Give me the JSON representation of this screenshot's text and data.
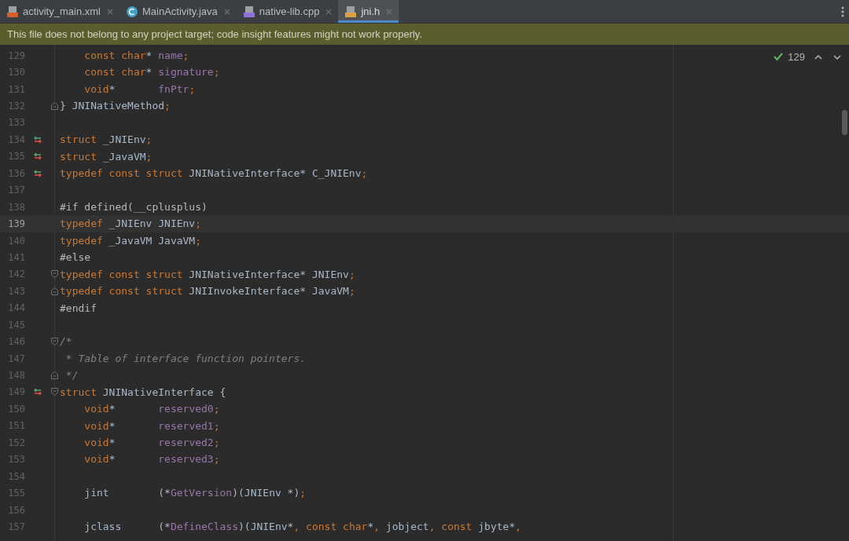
{
  "tabs": [
    {
      "label": "activity_main.xml",
      "kind": "xml",
      "selected": false
    },
    {
      "label": "MainActivity.java",
      "kind": "java",
      "selected": false
    },
    {
      "label": "native-lib.cpp",
      "kind": "cpp",
      "selected": false
    },
    {
      "label": "jni.h",
      "kind": "header",
      "selected": true
    }
  ],
  "banner": {
    "text": "This file does not belong to any project target; code insight features might not work properly."
  },
  "inspection": {
    "count": "129"
  },
  "lines": [
    {
      "number": "129",
      "current": false,
      "implemented": false,
      "fold_start": false,
      "fold_end": false,
      "tokens": [
        {
          "kind": "keyword",
          "text": "    const char"
        },
        {
          "kind": "plain",
          "text": "* "
        },
        {
          "kind": "field",
          "text": "name"
        },
        {
          "kind": "punct",
          "text": ";"
        }
      ]
    },
    {
      "number": "130",
      "current": false,
      "implemented": false,
      "fold_start": false,
      "fold_end": false,
      "tokens": [
        {
          "kind": "keyword",
          "text": "    const char"
        },
        {
          "kind": "plain",
          "text": "* "
        },
        {
          "kind": "field",
          "text": "signature"
        },
        {
          "kind": "punct",
          "text": ";"
        }
      ]
    },
    {
      "number": "131",
      "current": false,
      "implemented": false,
      "fold_start": false,
      "fold_end": false,
      "tokens": [
        {
          "kind": "keyword",
          "text": "    void"
        },
        {
          "kind": "plain",
          "text": "*       "
        },
        {
          "kind": "field",
          "text": "fnPtr"
        },
        {
          "kind": "punct",
          "text": ";"
        }
      ]
    },
    {
      "number": "132",
      "current": false,
      "implemented": false,
      "fold_start": false,
      "fold_end": true,
      "tokens": [
        {
          "kind": "plain",
          "text": "} JNINativeMethod"
        },
        {
          "kind": "punct",
          "text": ";"
        }
      ]
    },
    {
      "number": "133",
      "current": false,
      "implemented": false,
      "fold_start": false,
      "fold_end": false
    },
    {
      "number": "134",
      "current": false,
      "implemented": true,
      "fold_start": false,
      "fold_end": false,
      "tokens": [
        {
          "kind": "keyword",
          "text": "struct"
        },
        {
          "kind": "plain",
          "text": " _JNIEnv"
        },
        {
          "kind": "punct",
          "text": ";"
        }
      ]
    },
    {
      "number": "135",
      "current": false,
      "implemented": true,
      "fold_start": false,
      "fold_end": false,
      "tokens": [
        {
          "kind": "keyword",
          "text": "struct"
        },
        {
          "kind": "plain",
          "text": " _JavaVM"
        },
        {
          "kind": "punct",
          "text": ";"
        }
      ]
    },
    {
      "number": "136",
      "current": false,
      "implemented": true,
      "fold_start": false,
      "fold_end": false,
      "tokens": [
        {
          "kind": "keyword",
          "text": "typedef const struct"
        },
        {
          "kind": "plain",
          "text": " JNINativeInterface* C_JNIEnv"
        },
        {
          "kind": "punct",
          "text": ";"
        }
      ]
    },
    {
      "number": "137",
      "current": false,
      "implemented": false,
      "fold_start": false,
      "fold_end": false
    },
    {
      "number": "138",
      "current": false,
      "implemented": false,
      "fold_start": false,
      "fold_end": false,
      "tokens": [
        {
          "kind": "directive",
          "text": "#if defined(__cplusplus)"
        }
      ]
    },
    {
      "number": "139",
      "current": true,
      "implemented": false,
      "fold_start": false,
      "fold_end": false,
      "tokens": [
        {
          "kind": "keyword",
          "text": "typedef"
        },
        {
          "kind": "plain",
          "text": " _JNIEnv JNIEnv"
        },
        {
          "kind": "punct",
          "text": ";"
        }
      ]
    },
    {
      "number": "140",
      "current": false,
      "implemented": false,
      "fold_start": false,
      "fold_end": false,
      "tokens": [
        {
          "kind": "keyword",
          "text": "typedef"
        },
        {
          "kind": "plain",
          "text": " _JavaVM JavaVM"
        },
        {
          "kind": "punct",
          "text": ";"
        }
      ]
    },
    {
      "number": "141",
      "current": false,
      "implemented": false,
      "fold_start": false,
      "fold_end": false,
      "tokens": [
        {
          "kind": "directive",
          "text": "#else"
        }
      ]
    },
    {
      "number": "142",
      "current": false,
      "implemented": false,
      "fold_start": true,
      "fold_end": false,
      "tokens": [
        {
          "kind": "keyword",
          "text": "typedef const struct"
        },
        {
          "kind": "plain",
          "text": " JNINativeInterface* JNIEnv"
        },
        {
          "kind": "punct",
          "text": ";"
        }
      ]
    },
    {
      "number": "143",
      "current": false,
      "implemented": false,
      "fold_start": false,
      "fold_end": true,
      "tokens": [
        {
          "kind": "keyword",
          "text": "typedef const struct"
        },
        {
          "kind": "plain",
          "text": " JNIInvokeInterface* JavaVM"
        },
        {
          "kind": "punct",
          "text": ";"
        }
      ]
    },
    {
      "number": "144",
      "current": false,
      "implemented": false,
      "fold_start": false,
      "fold_end": false,
      "tokens": [
        {
          "kind": "directive",
          "text": "#endif"
        }
      ]
    },
    {
      "number": "145",
      "current": false,
      "implemented": false,
      "fold_start": false,
      "fold_end": false
    },
    {
      "number": "146",
      "current": false,
      "implemented": false,
      "fold_start": true,
      "fold_end": false,
      "tokens": [
        {
          "kind": "comment",
          "text": "/*"
        }
      ]
    },
    {
      "number": "147",
      "current": false,
      "implemented": false,
      "fold_start": false,
      "fold_end": false,
      "tokens": [
        {
          "kind": "comment",
          "text": " * Table of interface function pointers."
        }
      ]
    },
    {
      "number": "148",
      "current": false,
      "implemented": false,
      "fold_start": false,
      "fold_end": true,
      "tokens": [
        {
          "kind": "comment",
          "text": " */"
        }
      ]
    },
    {
      "number": "149",
      "current": false,
      "implemented": true,
      "fold_start": true,
      "fold_end": false,
      "tokens": [
        {
          "kind": "keyword",
          "text": "struct"
        },
        {
          "kind": "plain",
          "text": " JNINativeInterface {"
        }
      ]
    },
    {
      "number": "150",
      "current": false,
      "implemented": false,
      "fold_start": false,
      "fold_end": false,
      "tokens": [
        {
          "kind": "keyword",
          "text": "    void"
        },
        {
          "kind": "plain",
          "text": "*       "
        },
        {
          "kind": "field",
          "text": "reserved0"
        },
        {
          "kind": "punct",
          "text": ";"
        }
      ]
    },
    {
      "number": "151",
      "current": false,
      "implemented": false,
      "fold_start": false,
      "fold_end": false,
      "tokens": [
        {
          "kind": "keyword",
          "text": "    void"
        },
        {
          "kind": "plain",
          "text": "*       "
        },
        {
          "kind": "field",
          "text": "reserved1"
        },
        {
          "kind": "punct",
          "text": ";"
        }
      ]
    },
    {
      "number": "152",
      "current": false,
      "implemented": false,
      "fold_start": false,
      "fold_end": false,
      "tokens": [
        {
          "kind": "keyword",
          "text": "    void"
        },
        {
          "kind": "plain",
          "text": "*       "
        },
        {
          "kind": "field",
          "text": "reserved2"
        },
        {
          "kind": "punct",
          "text": ";"
        }
      ]
    },
    {
      "number": "153",
      "current": false,
      "implemented": false,
      "fold_start": false,
      "fold_end": false,
      "tokens": [
        {
          "kind": "keyword",
          "text": "    void"
        },
        {
          "kind": "plain",
          "text": "*       "
        },
        {
          "kind": "field",
          "text": "reserved3"
        },
        {
          "kind": "punct",
          "text": ";"
        }
      ]
    },
    {
      "number": "154",
      "current": false,
      "implemented": false,
      "fold_start": false,
      "fold_end": false
    },
    {
      "number": "155",
      "current": false,
      "implemented": false,
      "fold_start": false,
      "fold_end": false,
      "tokens": [
        {
          "kind": "plain",
          "text": "    jint        (*"
        },
        {
          "kind": "field",
          "text": "GetVersion"
        },
        {
          "kind": "plain",
          "text": ")(JNIEnv *)"
        },
        {
          "kind": "punct",
          "text": ";"
        }
      ]
    },
    {
      "number": "156",
      "current": false,
      "implemented": false,
      "fold_start": false,
      "fold_end": false
    },
    {
      "number": "157",
      "current": false,
      "implemented": false,
      "fold_start": false,
      "fold_end": false,
      "tokens": [
        {
          "kind": "plain",
          "text": "    jclass      (*"
        },
        {
          "kind": "field",
          "text": "DefineClass"
        },
        {
          "kind": "plain",
          "text": ")(JNIEnv*"
        },
        {
          "kind": "punct",
          "text": ", "
        },
        {
          "kind": "keyword",
          "text": "const char"
        },
        {
          "kind": "plain",
          "text": "*"
        },
        {
          "kind": "punct",
          "text": ", "
        },
        {
          "kind": "plain",
          "text": "jobject"
        },
        {
          "kind": "punct",
          "text": ", "
        },
        {
          "kind": "keyword",
          "text": "const"
        },
        {
          "kind": "plain",
          "text": " jbyte*"
        },
        {
          "kind": "punct",
          "text": ","
        }
      ]
    }
  ]
}
